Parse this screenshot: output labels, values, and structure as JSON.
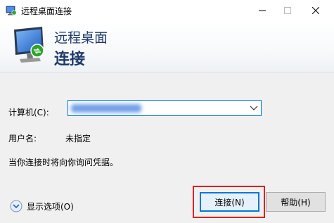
{
  "window": {
    "title": "远程桌面连接",
    "minimize_icon": "minimize-icon",
    "maximize_icon": "maximize-icon",
    "close_icon": "close-icon"
  },
  "banner": {
    "title": "远程桌面",
    "subtitle": "连接",
    "icon": "remote-desktop-monitor-icon"
  },
  "form": {
    "computer_label": "计算机(C):",
    "computer_value": "",
    "user_label": "用户名:",
    "user_value": "未指定",
    "info_text": "当你连接时将向你询问凭据。"
  },
  "footer": {
    "show_options_label": "显示选项(O)",
    "connect_label": "连接(N)",
    "help_label": "帮助(H)"
  },
  "colors": {
    "accent": "#0078d7",
    "title_text": "#1f3a6b",
    "highlight": "#e02020"
  }
}
